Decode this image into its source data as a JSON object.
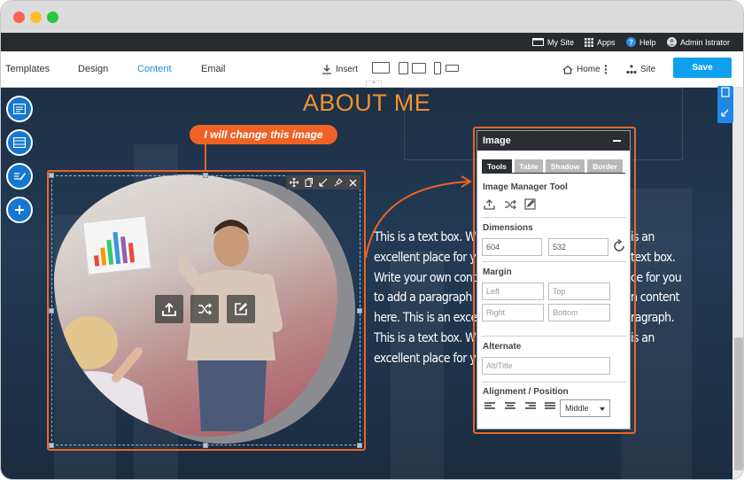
{
  "topbar": {
    "my_site": "My Site",
    "apps": "Apps",
    "help": "Help",
    "user": "Admin Istrator"
  },
  "nav": {
    "tabs": [
      {
        "label": "Templates",
        "active": false
      },
      {
        "label": "Design",
        "active": false
      },
      {
        "label": "Content",
        "active": true
      },
      {
        "label": "Email",
        "active": false
      }
    ],
    "insert": "Insert",
    "home": "Home",
    "site": "Site",
    "save": "Save"
  },
  "page": {
    "title": "ABOUT ME",
    "callout": "I will change this image",
    "text_lines": [
      "This is a text box. W",
      "excellent place for y",
      "Write your own cont",
      "to add a paragraph.",
      "here. This is an exce",
      "This is a text box. W",
      "excellent place for y"
    ],
    "text_lines_right": [
      "is an",
      "text box.",
      "ce for you",
      "n content",
      "ragraph.",
      "is an",
      ""
    ]
  },
  "panel": {
    "title": "Image",
    "tabs": [
      "Tools",
      "Table",
      "Shadow",
      "Border"
    ],
    "active_tab": "Tools",
    "image_manager_label": "Image Manager Tool",
    "dimensions_label": "Dimensions",
    "width": "604",
    "height": "532",
    "margin_label": "Margin",
    "margin_left_ph": "Left",
    "margin_top_ph": "Top",
    "margin_right_ph": "Right",
    "margin_bottom_ph": "Bottom",
    "alternate_label": "Alternate",
    "alt_ph": "Alt/Title",
    "alignment_label": "Alignment / Position",
    "position_value": "Middle"
  },
  "colors": {
    "accent_orange": "#ee6325",
    "title_orange": "#f09230",
    "save_blue": "#0ea1ee",
    "tool_blue": "#1577d0",
    "active_tab": "#1b8fd9"
  }
}
